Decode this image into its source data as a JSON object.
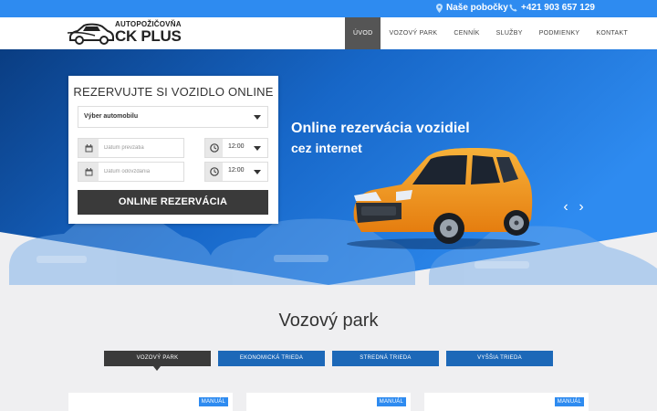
{
  "topbar": {
    "branches_label": "Naše pobočky",
    "phone": "+421 903 657 129"
  },
  "logo": {
    "line1": "AUTOPOŽIČOVŇA",
    "line2": "CK PLUS"
  },
  "nav": {
    "items": [
      {
        "label": "ÚVOD",
        "active": true
      },
      {
        "label": "VOZOVÝ PARK"
      },
      {
        "label": "CENNÍK"
      },
      {
        "label": "SLUŽBY"
      },
      {
        "label": "PODMIENKY"
      },
      {
        "label": "KONTAKT"
      }
    ]
  },
  "hero": {
    "title": "Online rezervácia vozidiel",
    "subtitle": "cez internet",
    "prev_icon": "chevron-left-icon",
    "next_icon": "chevron-right-icon",
    "prev_glyph": "‹",
    "next_glyph": "›"
  },
  "booking": {
    "heading": "REZERVUJTE SI VOZIDLO ONLINE",
    "car_select": "Výber automobilu",
    "pickup_placeholder": "Dátum prevzatia",
    "return_placeholder": "Dátum odovzdania",
    "pickup_time": "12:00",
    "return_time": "12:00",
    "submit_label": "ONLINE REZERVÁCIA"
  },
  "fleet": {
    "title": "Vozový park",
    "tabs": [
      {
        "label": "VOZOVÝ PARK",
        "active": true
      },
      {
        "label": "EKONOMICKÁ TRIEDA"
      },
      {
        "label": "STREDNÁ TRIEDA"
      },
      {
        "label": "VYŠŠIA TRIEDA"
      }
    ],
    "cards": [
      {
        "badge": "MANUÁL"
      },
      {
        "badge": "MANUÁL"
      },
      {
        "badge": "MANUÁL"
      }
    ]
  },
  "colors": {
    "accent": "#2e8bf0",
    "dark": "#3a3a3a",
    "car": "#f29a1e"
  }
}
